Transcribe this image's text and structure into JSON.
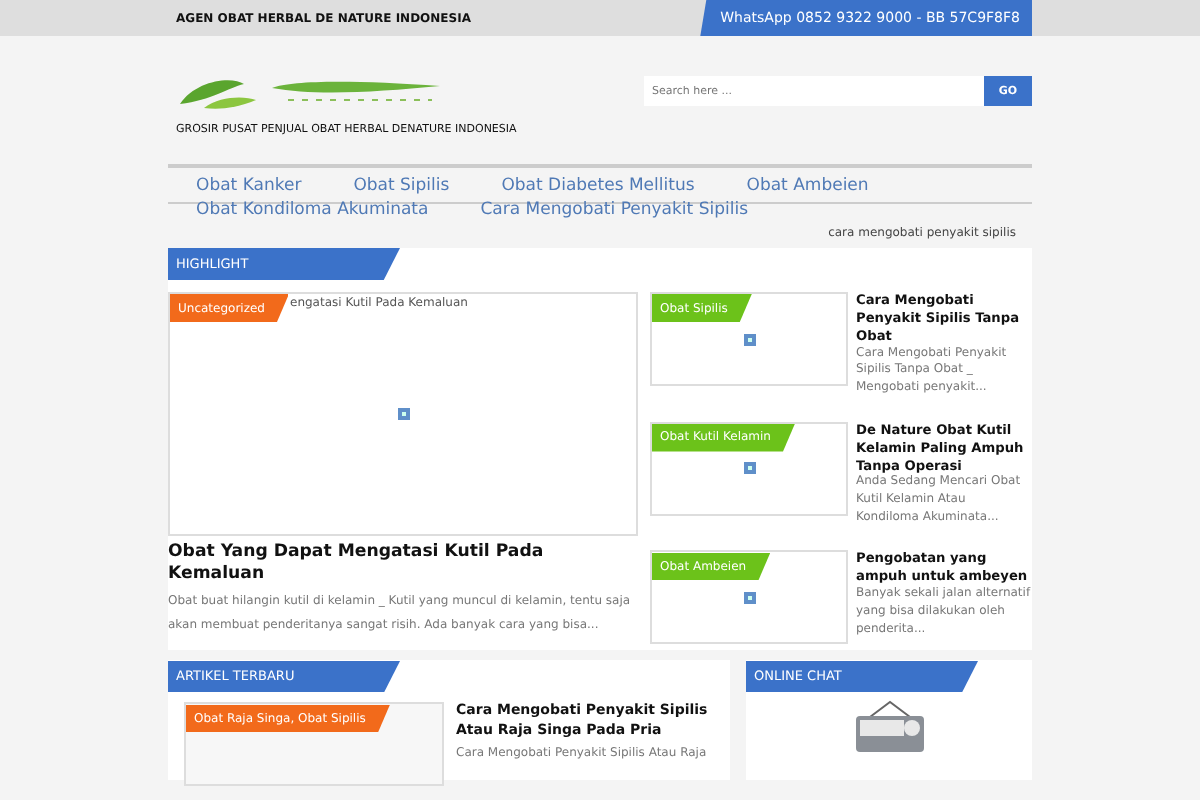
{
  "topbar": {
    "title": "AGEN OBAT HERBAL DE NATURE INDONESIA",
    "contact": "WhatsApp 0852 9322 9000 - BB 57C9F8F8"
  },
  "header": {
    "tagline": "GROSIR PUSAT PENJUAL OBAT HERBAL DENATURE INDONESIA",
    "search": {
      "placeholder": "Search here ..."
    },
    "search_button": "GO"
  },
  "nav": {
    "links": [
      "Obat Kanker",
      "Obat Sipilis",
      "Obat Diabetes Mellitus",
      "Obat Ambeien",
      "Obat Kondiloma Akuminata",
      "Cara Mengobati Penyakit Sipilis"
    ]
  },
  "breadcrumb_note": "cara mengobati penyakit sipilis",
  "highlight": {
    "heading": "HIGHLIGHT",
    "main": {
      "tag": "Uncategorized",
      "image_alt": "engatasi Kutil Pada Kemaluan",
      "title": "Obat Yang Dapat Mengatasi Kutil Pada Kemaluan",
      "excerpt": "Obat buat hilangin kutil di kelamin _ Kutil yang muncul di kelamin, tentu saja akan membuat penderitanya sangat risih. Ada banyak cara yang bisa..."
    },
    "items": [
      {
        "tag": "Obat Sipilis",
        "title": "Cara Mengobati Penyakit Sipilis Tanpa Obat",
        "excerpt": "Cara Mengobati Penyakit Sipilis Tanpa Obat _ Mengobati penyakit..."
      },
      {
        "tag": "Obat Kutil Kelamin",
        "title": "De Nature Obat Kutil Kelamin Paling Ampuh Tanpa Operasi",
        "excerpt": "Anda Sedang Mencari Obat Kutil Kelamin Atau Kondiloma Akuminata..."
      },
      {
        "tag": "Obat Ambeien",
        "title": "Pengobatan yang ampuh untuk ambeyen",
        "excerpt": "Banyak sekali jalan alternatif yang bisa dilakukan oleh penderita..."
      }
    ]
  },
  "latest": {
    "heading": "ARTIKEL TERBARU",
    "post": {
      "tag": "Obat Raja Singa, Obat Sipilis",
      "title": "Cara Mengobati Penyakit Sipilis Atau Raja Singa Pada Pria",
      "excerpt": "Cara Mengobati Penyakit Sipilis Atau Raja"
    }
  },
  "chat": {
    "heading": "ONLINE CHAT"
  }
}
